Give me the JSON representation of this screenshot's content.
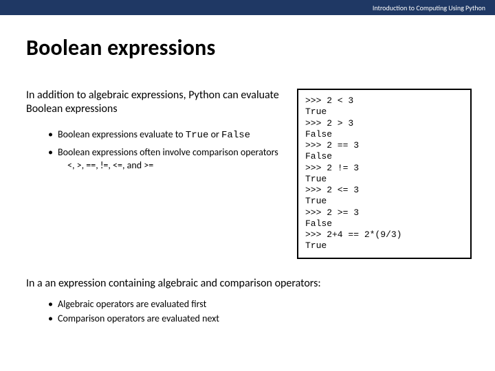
{
  "topbar": {
    "text": "Introduction to Computing Using Python"
  },
  "title": "Boolean expressions",
  "intro": "In addition to algebraic expressions, Python can evaluate Boolean expressions",
  "bullets": {
    "b0_a": "Boolean expressions evaluate to ",
    "b0_true": "True",
    "b0_or": " or ",
    "b0_false": "False",
    "b1": "Boolean expressions often involve comparison operators",
    "b1_ops": "<, >, ==, !=, <=, and >="
  },
  "code": ">>> 2 < 3\nTrue\n>>> 2 > 3\nFalse\n>>> 2 == 3\nFalse\n>>> 2 != 3\nTrue\n>>> 2 <= 3\nTrue\n>>> 2 >= 3\nFalse\n>>> 2+4 == 2*(9/3)\nTrue",
  "footer": {
    "text": "In a an expression containing algebraic and comparison operators:",
    "b0": "Algebraic operators are evaluated first",
    "b1": "Comparison operators are evaluated next"
  }
}
